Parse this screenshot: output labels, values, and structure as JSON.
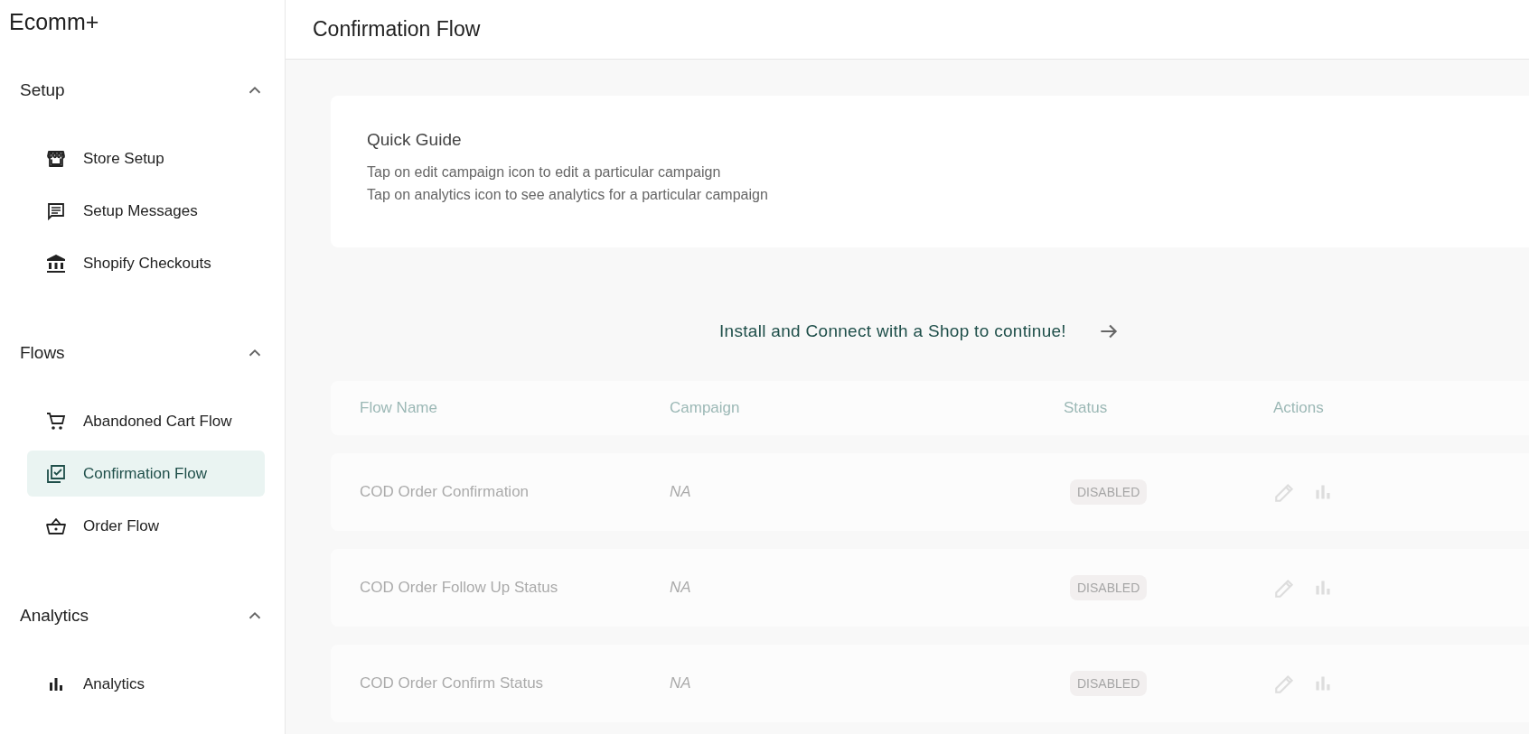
{
  "app": {
    "logo": "Ecomm+"
  },
  "sidebar": {
    "sections": [
      {
        "title": "Setup",
        "expanded": true,
        "items": [
          {
            "label": "Store Setup",
            "kind": "store",
            "selected": false
          },
          {
            "label": "Setup Messages",
            "kind": "message",
            "selected": false
          },
          {
            "label": "Shopify Checkouts",
            "kind": "bank",
            "selected": false
          }
        ]
      },
      {
        "title": "Flows",
        "expanded": true,
        "items": [
          {
            "label": "Abandoned Cart Flow",
            "kind": "cart",
            "selected": false
          },
          {
            "label": "Confirmation Flow",
            "kind": "checklist",
            "selected": true
          },
          {
            "label": "Order Flow",
            "kind": "basket",
            "selected": false
          }
        ]
      },
      {
        "title": "Analytics",
        "expanded": true,
        "items": [
          {
            "label": "Analytics",
            "kind": "chart",
            "selected": false
          }
        ]
      }
    ]
  },
  "header": {
    "title": "Confirmation Flow"
  },
  "quick_guide": {
    "title": "Quick Guide",
    "lines": [
      "Tap on edit campaign icon to edit a particular campaign",
      "Tap on analytics icon to see analytics for a particular campaign"
    ]
  },
  "notice": {
    "text": "Install and Connect with a Shop to continue!"
  },
  "table": {
    "dimmed": true,
    "columns": [
      "Flow Name",
      "Campaign",
      "Status",
      "Actions"
    ],
    "rows": [
      {
        "flow_name": "COD Order Confirmation",
        "campaign": "NA",
        "status": "DISABLED"
      },
      {
        "flow_name": "COD Order Follow Up Status",
        "campaign": "NA",
        "status": "DISABLED"
      },
      {
        "flow_name": "COD Order Confirm Status",
        "campaign": "NA",
        "status": "DISABLED"
      }
    ]
  }
}
